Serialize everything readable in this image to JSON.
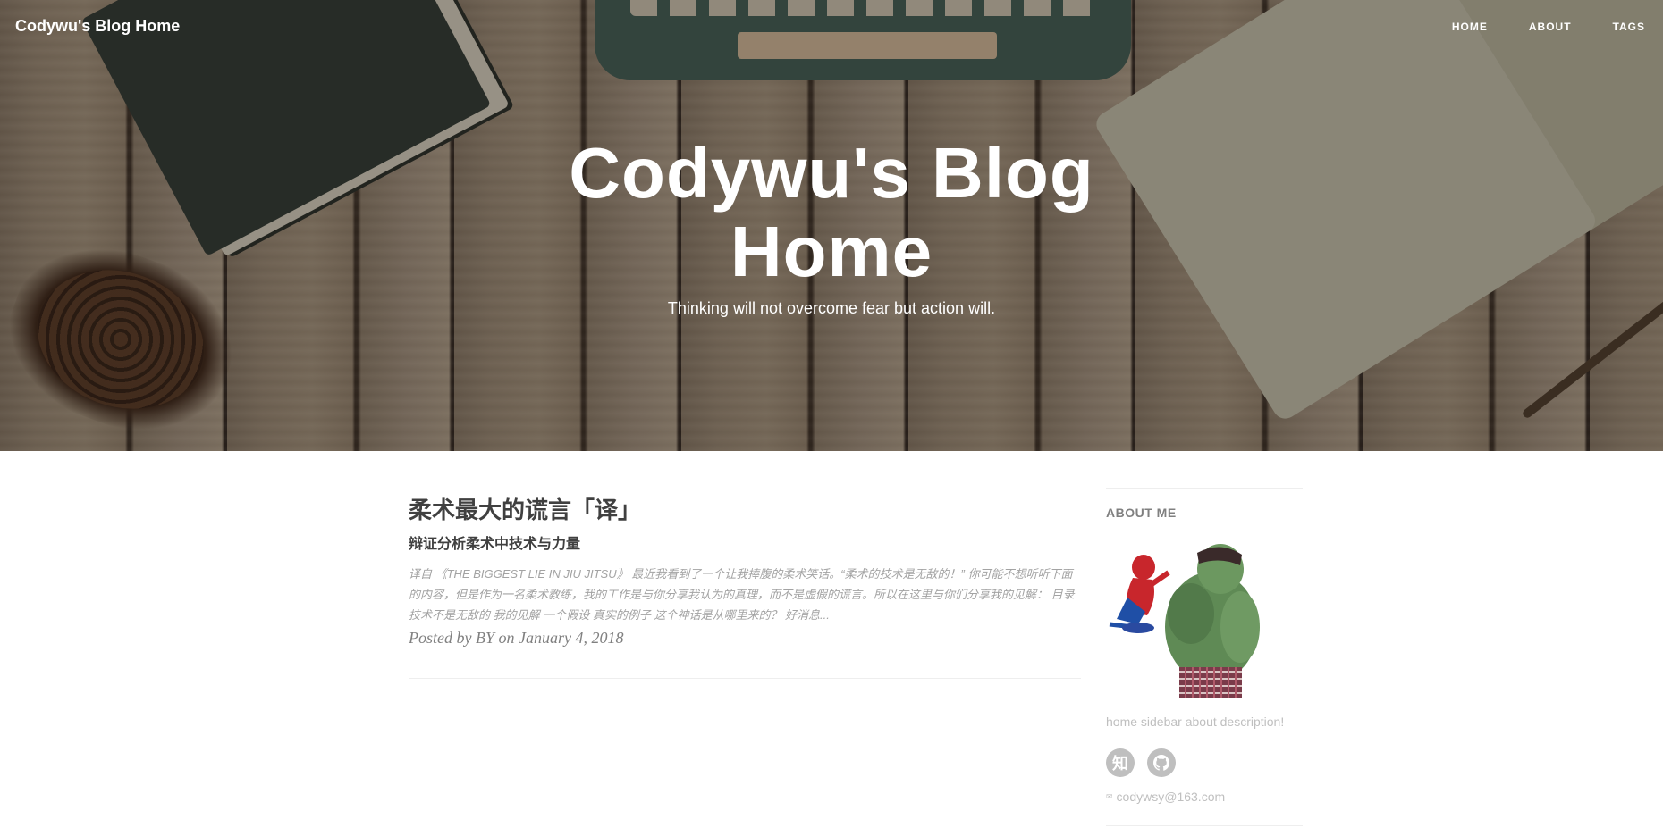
{
  "navbar": {
    "brand": "Codywu's Blog Home",
    "links": [
      "HOME",
      "ABOUT",
      "TAGS"
    ]
  },
  "hero": {
    "title": "Codywu's Blog Home",
    "subtitle": "Thinking will not overcome fear but action will."
  },
  "posts": [
    {
      "title": "柔术最大的谎言「译」",
      "subtitle": "辩证分析柔术中技术与力量",
      "excerpt": "译自 《THE BIGGEST LIE IN JIU JITSU》 最近我看到了一个让我捧腹的柔术笑话。“柔术的技术是无敌的！” 你可能不想听听下面的内容，但是作为一名柔术教练，我的工作是与你分享我认为的真理，而不是虚假的谎言。所以在这里与你们分享我的见解： 目录 技术不是无敌的 我的见解 一个假设 真实的例子 这个神话是从哪里来的？ 好消息...",
      "meta": "Posted by BY on January 4, 2018"
    }
  ],
  "sidebar": {
    "heading": "ABOUT ME",
    "description": "home sidebar about description!",
    "social": [
      {
        "icon": "zhihu-icon",
        "glyph": "知"
      },
      {
        "icon": "github-icon"
      }
    ],
    "email": "codywsy@163.com"
  }
}
